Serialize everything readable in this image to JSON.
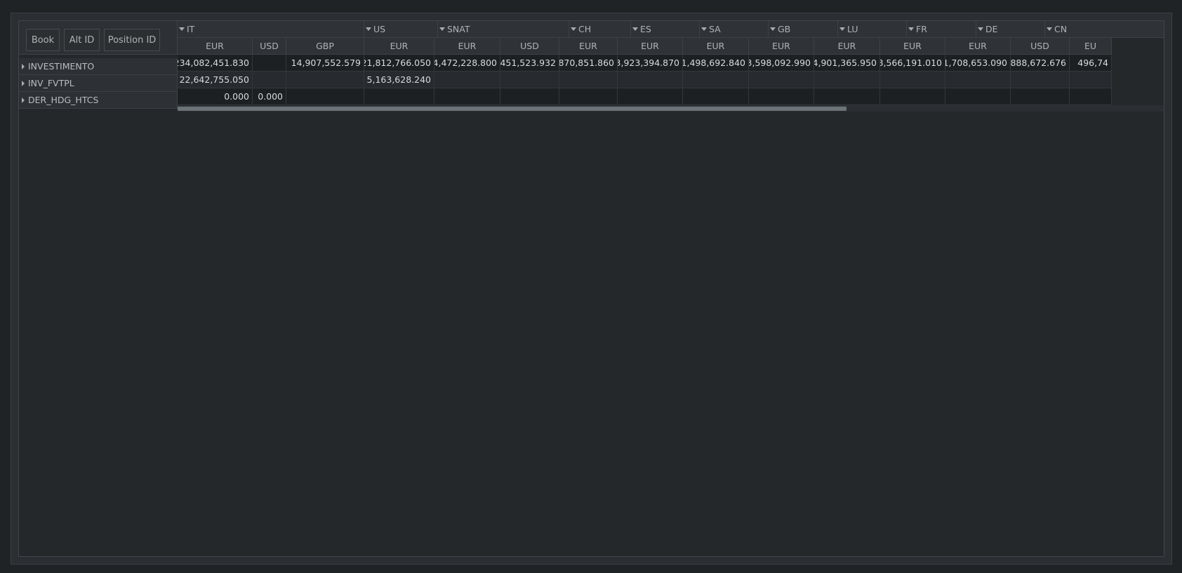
{
  "buttons": {
    "book": "Book",
    "alt_id": "Alt ID",
    "position_id": "Position ID"
  },
  "rows": [
    {
      "label": "INVESTIMENTO"
    },
    {
      "label": "INV_FVTPL"
    },
    {
      "label": "DER_HDG_HTCS"
    }
  ],
  "groups": [
    "IT",
    "US",
    "SNAT",
    "CH",
    "ES",
    "SA",
    "GB",
    "LU",
    "FR",
    "DE",
    "CN"
  ],
  "currencies": [
    "EUR",
    "USD",
    "GBP",
    "EUR",
    "EUR",
    "USD",
    "EUR",
    "EUR",
    "EUR",
    "EUR",
    "EUR",
    "EUR",
    "EUR",
    "USD",
    "EU"
  ],
  "cells": {
    "r0": [
      "234,082,451.830",
      "",
      "14,907,552.579",
      "21,812,766.050",
      "4,472,228.800",
      "451,523.932",
      "870,851.860",
      "3,923,394.870",
      "1,498,692.840",
      "3,598,092.990",
      "4,901,365.950",
      "8,566,191.010",
      "1,708,653.090",
      "888,672.676",
      "496,74"
    ],
    "r1": [
      "22,642,755.050",
      "",
      "",
      "5,163,628.240",
      "",
      "",
      "",
      "",
      "",
      "",
      "",
      "",
      "",
      "",
      ""
    ],
    "r2": [
      "0.000",
      "0.000",
      "",
      "",
      "",
      "",
      "",
      "",
      "",
      "",
      "",
      "",
      "",
      "",
      ""
    ]
  },
  "scrollbar": {
    "position_fraction": 0.0,
    "visible_fraction": 0.677
  },
  "colors": {
    "background": "#202326",
    "panel": "#25282b",
    "header": "#2f3337",
    "row_dark": "#1d2023",
    "text": "#d7dade"
  }
}
